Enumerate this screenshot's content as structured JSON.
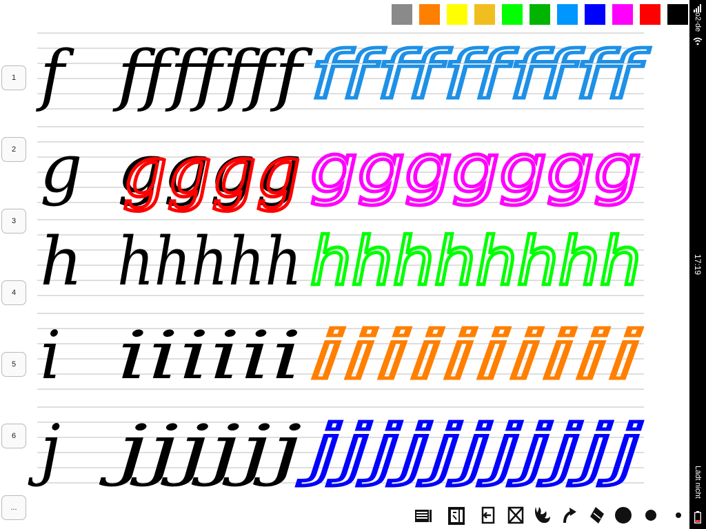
{
  "status": {
    "carrier": "o2-de",
    "time": "17:19",
    "battery_text": "Lädt nicht"
  },
  "palette": [
    {
      "name": "gray",
      "color": "#8a8a8a"
    },
    {
      "name": "orange",
      "color": "#ff7f00"
    },
    {
      "name": "yellow",
      "color": "#ffff00"
    },
    {
      "name": "gold",
      "color": "#f0be1e"
    },
    {
      "name": "green",
      "color": "#00ff00"
    },
    {
      "name": "dark-green",
      "color": "#00b400"
    },
    {
      "name": "sky-blue",
      "color": "#0096ff"
    },
    {
      "name": "blue",
      "color": "#0000ff"
    },
    {
      "name": "magenta",
      "color": "#ff00ff"
    },
    {
      "name": "red",
      "color": "#ff0000"
    },
    {
      "name": "black",
      "color": "#000000"
    }
  ],
  "page_tabs": [
    "1",
    "2",
    "3",
    "4",
    "5",
    "6",
    "..."
  ],
  "worksheet": {
    "rows": [
      {
        "letter": "f",
        "model_repeat": "fffffff",
        "drawn_color": "#1e90e6",
        "drawn_count": 10,
        "drawn_text": "ffffffffff"
      },
      {
        "letter": "g",
        "model_repeat": "gggg",
        "drawn_color": "#ff00ff",
        "drawn_count": 7,
        "drawn_text": "ggggggg",
        "overlay_color": "#ff0000"
      },
      {
        "letter": "h",
        "model_repeat": "hhhhh",
        "drawn_color": "#00ff00",
        "drawn_count": 8,
        "drawn_text": "hhhhhhhh"
      },
      {
        "letter": "i",
        "model_repeat": "iiiiii",
        "drawn_color": "#ff7f00",
        "drawn_count": 10,
        "drawn_text": "iiiiiiiiii"
      },
      {
        "letter": "j",
        "model_repeat": "jjjjjj",
        "drawn_color": "#0000ff",
        "drawn_count": 11,
        "drawn_text": "jjjjjjjjjjj"
      }
    ]
  },
  "toolbar": [
    "list-icon",
    "edit-page-icon",
    "back-icon",
    "clear-icon",
    "hand-icon",
    "redo-icon",
    "eraser-icon",
    "brush-large-icon",
    "brush-medium-icon",
    "brush-small-icon"
  ]
}
